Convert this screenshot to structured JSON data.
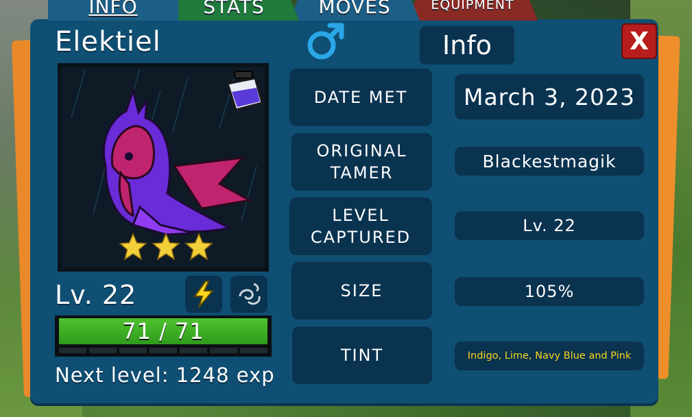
{
  "tabs": [
    {
      "label": "INFO"
    },
    {
      "label": "STATS"
    },
    {
      "label": "MOVES"
    },
    {
      "label": "EQUIPMENT"
    }
  ],
  "panel": {
    "title": "Info",
    "close_label": "X"
  },
  "creature": {
    "name": "Elektiel",
    "gender_icon": "male-symbol-icon",
    "stars": 3,
    "level_text": "Lv. 22",
    "types": [
      "electric-bolt-icon",
      "wind-swirl-icon"
    ],
    "held_item_icon": "potion-jar-icon",
    "hp": {
      "current": 71,
      "max": 71,
      "text": "71 / 71"
    },
    "next_level_text": "Next level: 1248 exp"
  },
  "info_rows": [
    {
      "label": "DATE MET",
      "value": "March 3, 2023"
    },
    {
      "label": "ORIGINAL TAMER",
      "value": "Blackestmagik"
    },
    {
      "label": "LEVEL CAPTURED",
      "value": "Lv. 22"
    },
    {
      "label": "SIZE",
      "value": "105%"
    },
    {
      "label": "TINT",
      "value": "Indigo, Lime, Navy Blue and Pink"
    }
  ],
  "colors": {
    "panel": "#0f4f73",
    "box": "#0a3350",
    "close": "#b81d1d",
    "hp_bar": "#3fb22a",
    "tint_text": "#f7d51a",
    "star": "#f3cf3a",
    "gender": "#2aa7e8"
  }
}
